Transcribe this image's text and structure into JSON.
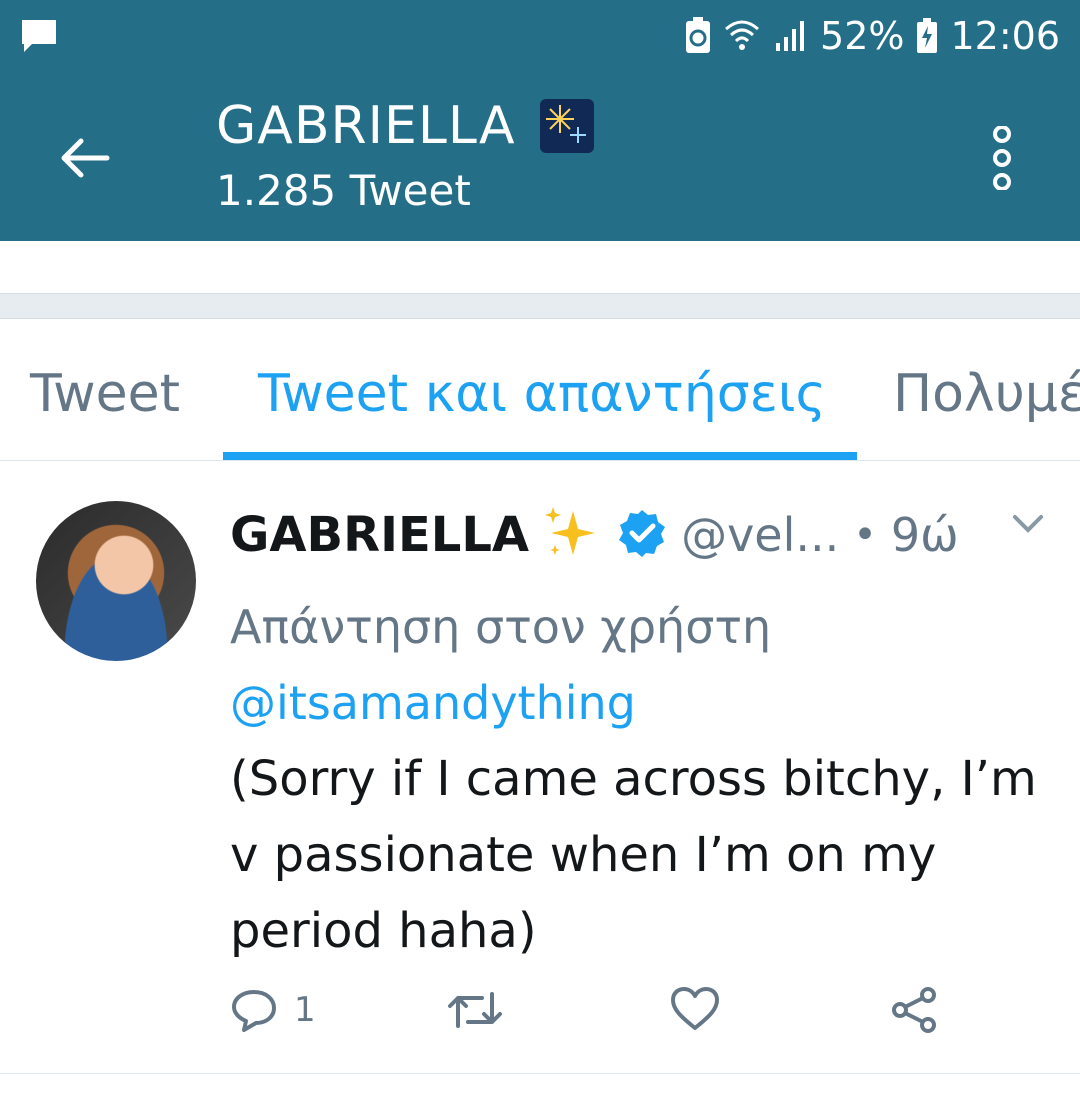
{
  "status_bar": {
    "battery_percent": "52%",
    "time": "12:06",
    "icons": [
      "message-icon",
      "recycle-icon",
      "wifi-icon",
      "signal-icon",
      "battery-icon"
    ]
  },
  "header": {
    "title": "GABRIELLA",
    "title_emoji": "fireworks-icon",
    "subtitle": "1.285 Tweet",
    "background": "#246f87"
  },
  "tabs": [
    {
      "label": "Tweet",
      "active": false
    },
    {
      "label": "Tweet και απαντήσεις",
      "active": true
    },
    {
      "label": "Πολυμέ",
      "active": false
    }
  ],
  "tweet": {
    "author_name": "GABRIELLA",
    "handle": "@vel...",
    "time_ago": "9ώ",
    "reply_prefix": "Απάντηση στον χρήστη",
    "reply_mention": "@itsamandything",
    "text": "(Sorry if I came across bitchy, I’m v passionate when I’m on my period haha)",
    "reply_count": "1",
    "accent": "#1da1f2"
  }
}
